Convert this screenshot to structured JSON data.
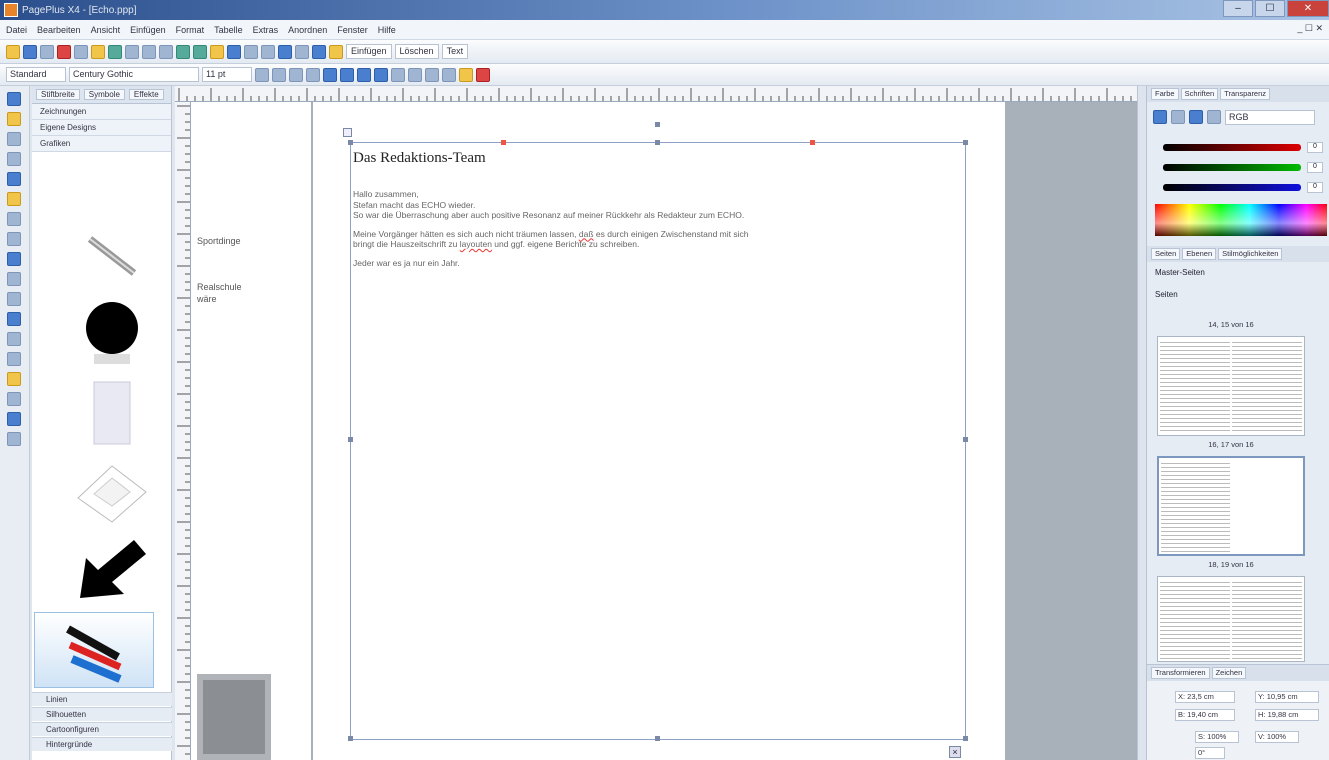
{
  "window": {
    "title": "PagePlus X4 - [Echo.ppp]"
  },
  "menu": [
    "Datei",
    "Bearbeiten",
    "Ansicht",
    "Einfügen",
    "Format",
    "Tabelle",
    "Extras",
    "Anordnen",
    "Fenster",
    "Hilfe"
  ],
  "mdi_controls": "_ ☐ ✕",
  "toolbar": {
    "button1_label": "Einfügen",
    "button2_label": "Löschen",
    "button3_label": "Text"
  },
  "format_bar": {
    "style_value": "Standard",
    "font_value": "Century Gothic",
    "size_value": "11 pt"
  },
  "gallery": {
    "tabs": [
      "Stiftbreite",
      "Symbole",
      "Effekte"
    ],
    "category_button": "Zeichnungen",
    "section_header": "Eigene Designs",
    "subsection": "Grafiken",
    "bottom_items": [
      "Linien",
      "Silhouetten",
      "Cartoonfiguren",
      "Hintergründe"
    ]
  },
  "document": {
    "left_fragment_1": "Sportdinge",
    "left_fragment_2": "Realschule",
    "left_fragment_3": "wäre",
    "title": "Das Redaktions-Team",
    "para1": [
      "Hallo zusammen,",
      "Stefan macht das ECHO wieder.",
      "So war die Überraschung aber auch positive Resonanz auf meiner Rückkehr als Redakteur zum ECHO."
    ],
    "para2_a": "Meine Vorgänger hätten es sich auch nicht träumen lassen, ",
    "para2_b": "daß",
    "para2_c": " es durch einigen Zwischenstand mit sich",
    "para2_d": "bringt die Hauszeitschrift zu ",
    "para2_e": "layouten",
    "para2_f": " und ggf. eigene Berichte zu schreiben.",
    "para3": "Jeder war es ja nur ein Jahr."
  },
  "right_panel": {
    "color_tabs": [
      "Farbe",
      "Schriften",
      "Transparenz"
    ],
    "color_mode": "RGB",
    "rgb_values": [
      "0",
      "0",
      "0"
    ],
    "pages_tabs": [
      "Seiten",
      "Ebenen",
      "Stilmöglichkeiten"
    ],
    "pages_header": "Master-Seiten",
    "pages_sub": "Seiten",
    "page_labels": [
      "14, 15 von 16",
      "16, 17 von 16",
      "18, 19 von 16"
    ],
    "transform_tabs": [
      "Transformieren",
      "Zeichen"
    ],
    "transform_fields": [
      "X: 23,5 cm",
      "Y: 10,95 cm",
      "B: 19,40 cm",
      "H: 19,88 cm",
      "S: 100%",
      "V: 100%",
      "0°"
    ]
  }
}
